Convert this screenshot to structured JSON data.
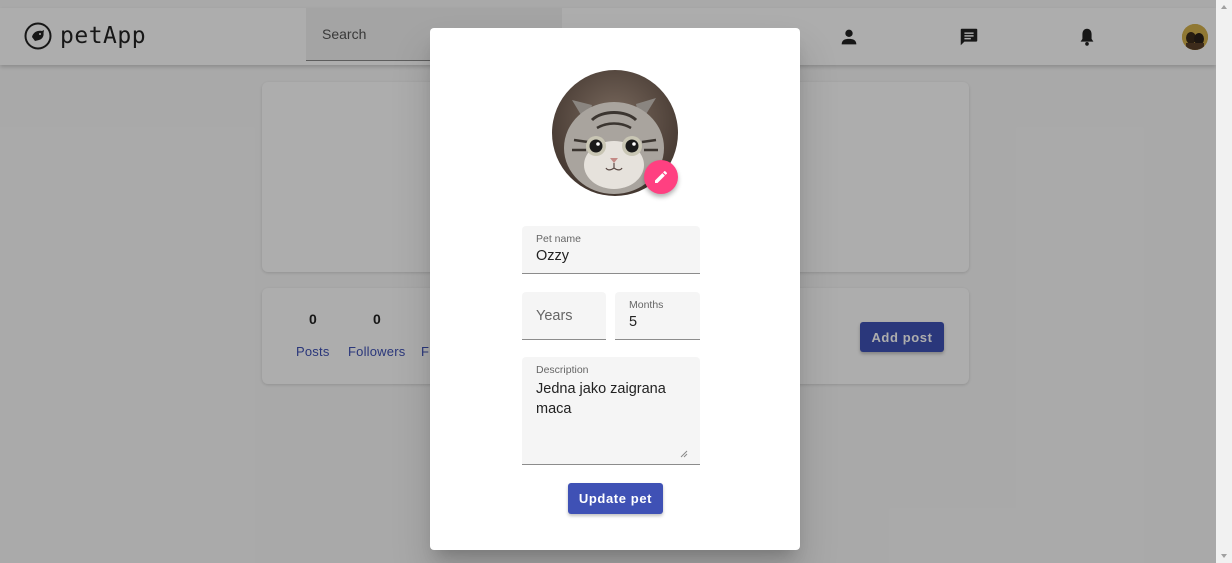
{
  "appbar": {
    "logo_text": "petApp",
    "search_placeholder": "Search"
  },
  "profile_stats": {
    "posts_count": "0",
    "followers_count": "0",
    "posts_label": "Posts",
    "followers_label": "Followers",
    "following_label_partial": "F"
  },
  "add_post_label": "Add post",
  "dialog": {
    "pet_name_label": "Pet name",
    "pet_name_value": "Ozzy",
    "years_placeholder": "Years",
    "months_label": "Months",
    "months_value": "5",
    "description_label": "Description",
    "description_value": "Jedna jako zaigrana maca",
    "update_button_label": "Update pet"
  },
  "colors": {
    "primary": "#3f51b5",
    "accent": "#ff4081",
    "backdrop": "rgba(0,0,0,0.32)"
  },
  "icons": [
    "pet-logo-icon",
    "person-icon",
    "chat-icon",
    "bell-icon",
    "pencil-icon"
  ]
}
